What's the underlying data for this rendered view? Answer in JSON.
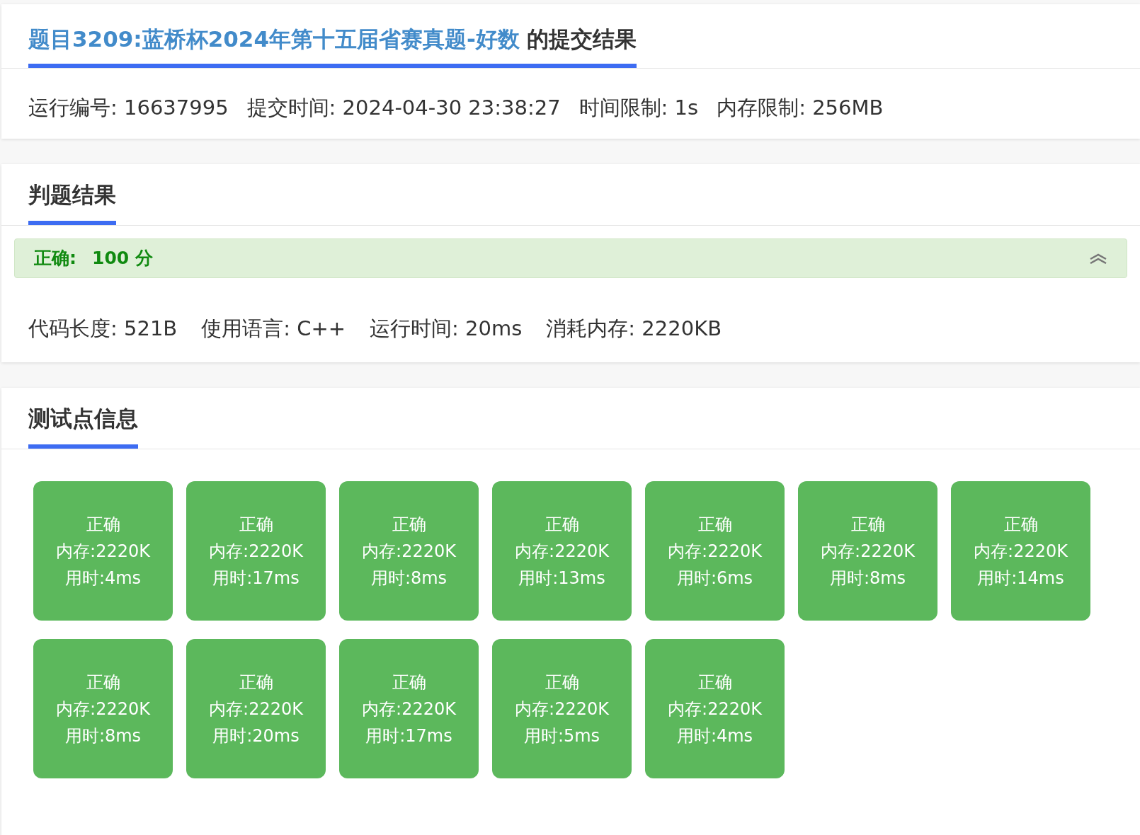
{
  "submission": {
    "problem_link": "题目3209:蓝桥杯2024年第十五届省赛真题-好数",
    "title_suffix": "的提交结果",
    "info": [
      "运行编号: 16637995",
      "提交时间: 2024-04-30 23:38:27",
      "时间限制: 1s",
      "内存限制: 256MB"
    ]
  },
  "judge": {
    "heading": "判题结果",
    "verdict": {
      "kind": "accepted",
      "label": "正确:",
      "score": "100 分",
      "expanded": true
    },
    "stats": [
      "代码长度: 521B",
      "使用语言: C++",
      "运行时间: 20ms",
      "消耗内存: 2220KB"
    ]
  },
  "tests": {
    "heading": "测试点信息",
    "items": [
      {
        "kind": "accepted",
        "status": "正确",
        "memory": "内存:2220K",
        "time": "用时:4ms"
      },
      {
        "kind": "accepted",
        "status": "正确",
        "memory": "内存:2220K",
        "time": "用时:17ms"
      },
      {
        "kind": "accepted",
        "status": "正确",
        "memory": "内存:2220K",
        "time": "用时:8ms"
      },
      {
        "kind": "accepted",
        "status": "正确",
        "memory": "内存:2220K",
        "time": "用时:13ms"
      },
      {
        "kind": "accepted",
        "status": "正确",
        "memory": "内存:2220K",
        "time": "用时:6ms"
      },
      {
        "kind": "accepted",
        "status": "正确",
        "memory": "内存:2220K",
        "time": "用时:8ms"
      },
      {
        "kind": "accepted",
        "status": "正确",
        "memory": "内存:2220K",
        "time": "用时:14ms"
      },
      {
        "kind": "accepted",
        "status": "正确",
        "memory": "内存:2220K",
        "time": "用时:8ms"
      },
      {
        "kind": "accepted",
        "status": "正确",
        "memory": "内存:2220K",
        "time": "用时:20ms"
      },
      {
        "kind": "accepted",
        "status": "正确",
        "memory": "内存:2220K",
        "time": "用时:17ms"
      },
      {
        "kind": "accepted",
        "status": "正确",
        "memory": "内存:2220K",
        "time": "用时:5ms"
      },
      {
        "kind": "accepted",
        "status": "正确",
        "memory": "内存:2220K",
        "time": "用时:4ms"
      }
    ]
  }
}
